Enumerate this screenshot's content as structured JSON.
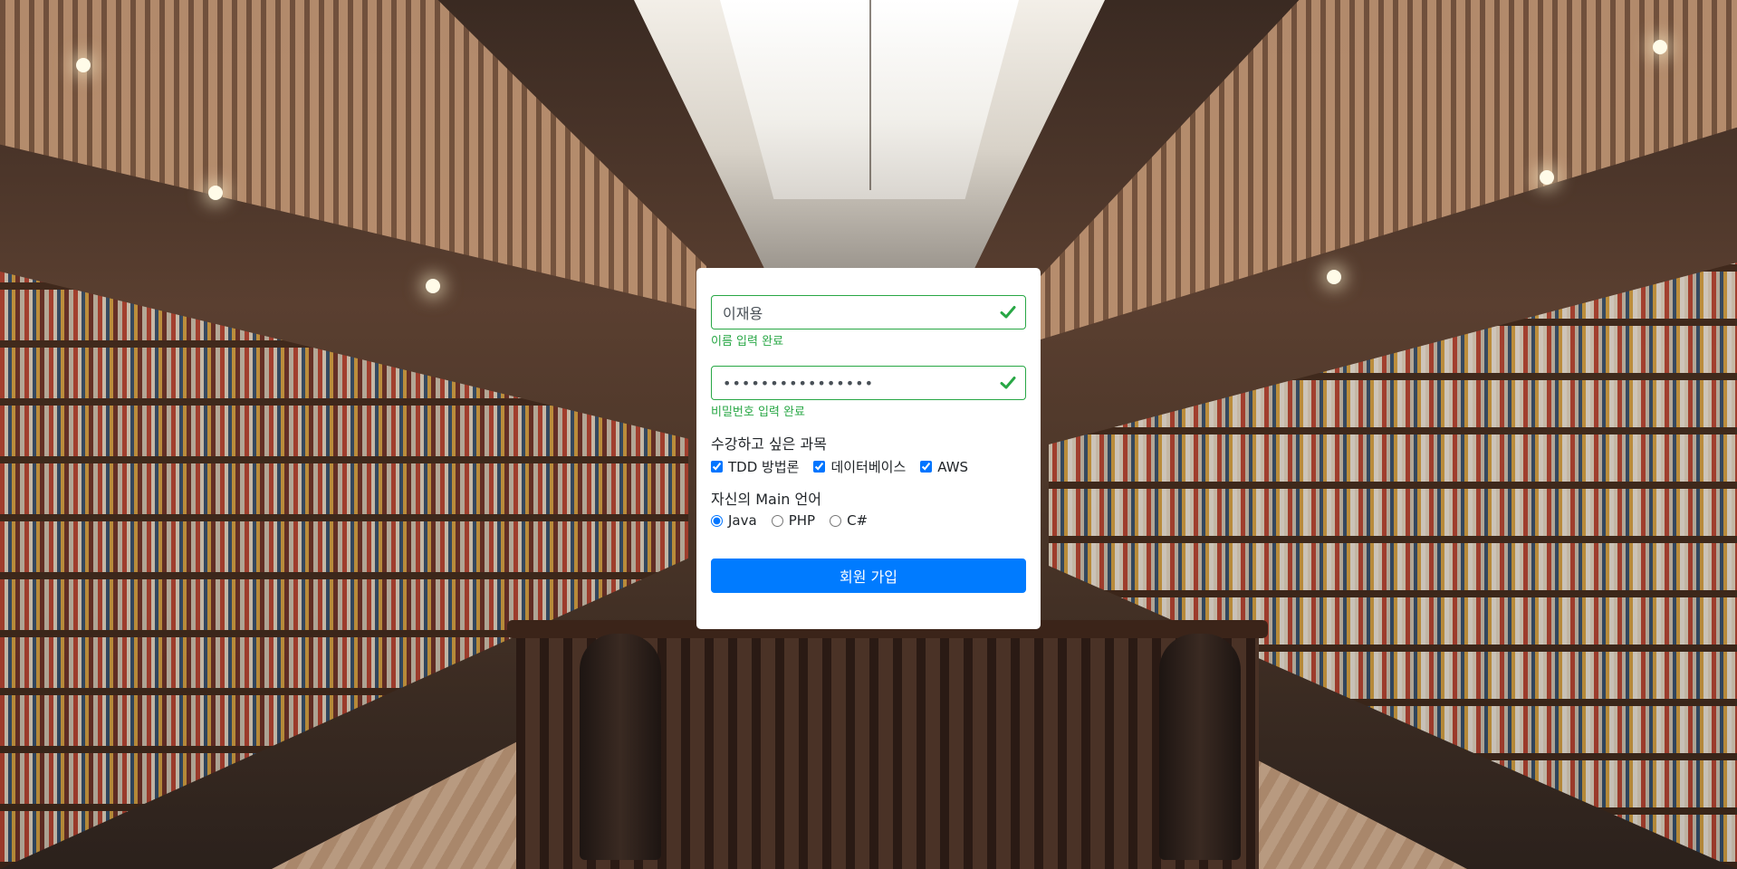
{
  "form": {
    "name": {
      "value": "이재용",
      "feedback": "이름 입력 완료"
    },
    "password": {
      "value": "••••••••••••••••",
      "feedback": "비밀번호 입력 완료"
    },
    "courses": {
      "label": "수강하고 싶은 과목",
      "options": [
        {
          "label": "TDD 방법론",
          "checked": true
        },
        {
          "label": "데이터베이스",
          "checked": true
        },
        {
          "label": "AWS",
          "checked": true
        }
      ]
    },
    "language": {
      "label": "자신의 Main 언어",
      "options": [
        {
          "label": "Java",
          "checked": true
        },
        {
          "label": "PHP",
          "checked": false
        },
        {
          "label": "C#",
          "checked": false
        }
      ]
    },
    "submit_label": "회원 가입"
  },
  "colors": {
    "valid": "#28a745",
    "primary": "#007bff"
  },
  "icons": {
    "valid": "check-icon"
  }
}
